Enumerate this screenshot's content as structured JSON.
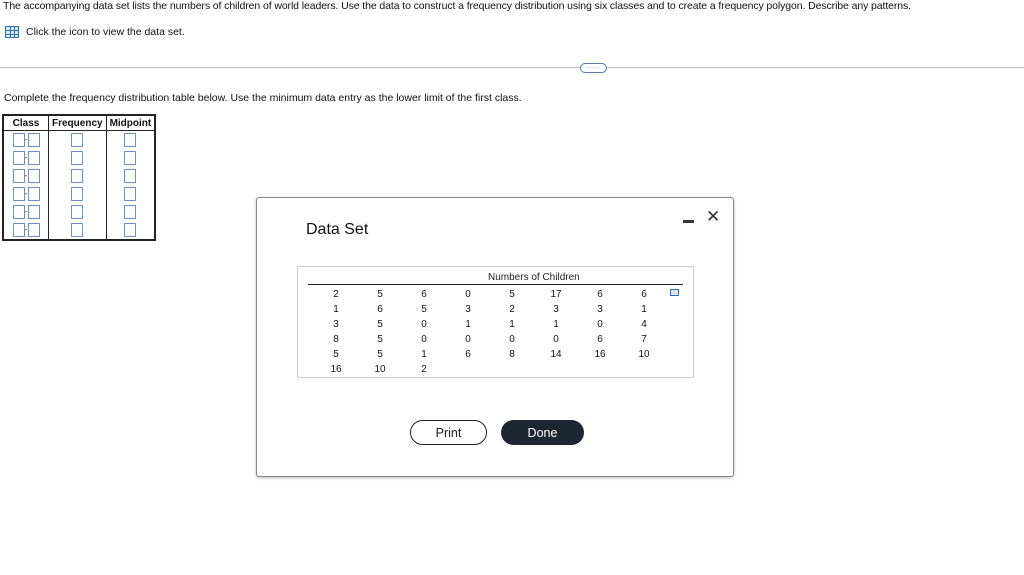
{
  "question": {
    "prompt": "The accompanying data set lists the numbers of children of world leaders. Use the data to construct a frequency distribution using six classes and to create a frequency polygon. Describe any patterns.",
    "dataset_link": "Click the icon to view the data set.",
    "instruction": "Complete the frequency distribution table below. Use the minimum data entry as the lower limit of the first class.",
    "expander": "....."
  },
  "freq_table": {
    "headers": [
      "Class",
      "Frequency",
      "Midpoint"
    ],
    "class_separator": "-",
    "rows": 6
  },
  "dialog": {
    "title": "Data Set",
    "table_caption": "Numbers of Children",
    "columns": [
      [
        "2",
        "1",
        "3",
        "8",
        "5",
        "16"
      ],
      [
        "5",
        "6",
        "5",
        "5",
        "5",
        "10"
      ],
      [
        "6",
        "5",
        "0",
        "0",
        "1",
        "2"
      ],
      [
        "0",
        "3",
        "1",
        "0",
        "6"
      ],
      [
        "5",
        "2",
        "1",
        "0",
        "8"
      ],
      [
        "17",
        "3",
        "1",
        "0",
        "14"
      ],
      [
        "6",
        "3",
        "0",
        "6",
        "16"
      ],
      [
        "6",
        "1",
        "4",
        "7",
        "10"
      ]
    ],
    "print_label": "Print",
    "done_label": "Done",
    "close_glyph": "✕"
  }
}
